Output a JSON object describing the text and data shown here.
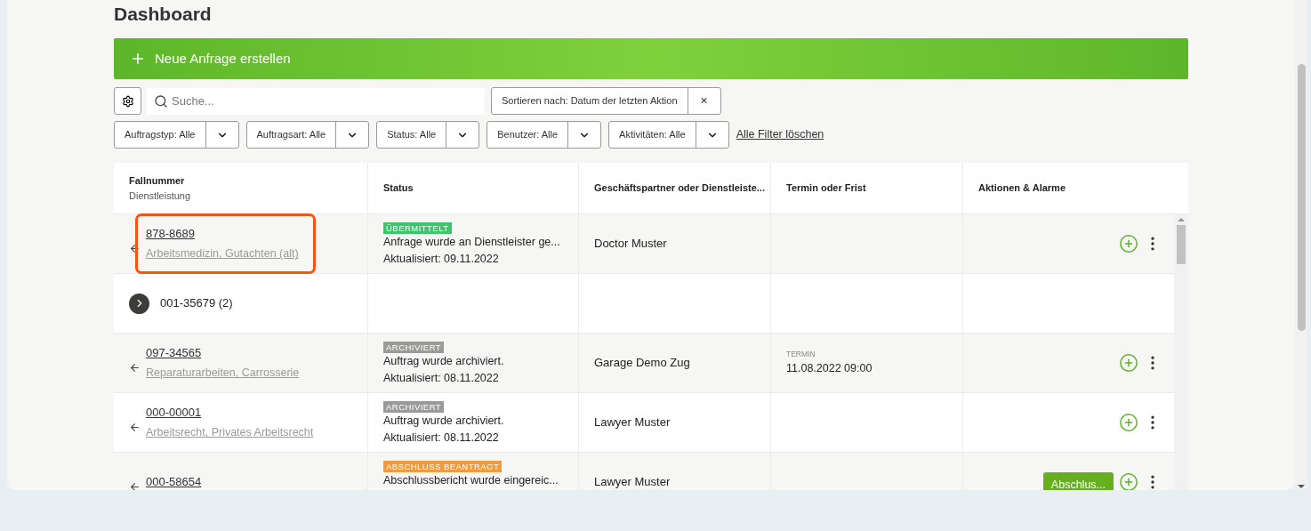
{
  "page_title": "Dashboard",
  "create_button": {
    "label": "Neue Anfrage erstellen"
  },
  "search": {
    "placeholder": "Suche..."
  },
  "sort": {
    "label": "Sortieren nach: Datum der letzten Aktion",
    "clear": "×"
  },
  "filters": [
    {
      "label": "Auftragstyp: Alle"
    },
    {
      "label": "Auftragsart: Alle"
    },
    {
      "label": "Status: Alle"
    },
    {
      "label": "Benutzer: Alle"
    },
    {
      "label": "Aktivitäten: Alle"
    }
  ],
  "clear_filters": "Alle Filter löschen",
  "table": {
    "columns": [
      {
        "title": "Fallnummer",
        "subtitle": "Dienstleistung"
      },
      {
        "title": "Status"
      },
      {
        "title": "Geschäftspartner oder Dienstleiste..."
      },
      {
        "title": "Termin oder Frist"
      },
      {
        "title": "Aktionen & Alarme"
      }
    ],
    "rows": [
      {
        "kind": "case",
        "highlighted": true,
        "number": "878-8689",
        "service": "Arbeitsmedizin, Gutachten (alt)",
        "badge": "ÜBERMITTELT",
        "color": "#3fc36b",
        "message": "Anfrage wurde an Dienstleister ge...",
        "updated": "Aktualisiert: 09.11.2022",
        "partner": "Doctor Muster"
      },
      {
        "kind": "group",
        "number": "001-35679 (2)"
      },
      {
        "kind": "case",
        "highlighted": false,
        "number": "097-34565",
        "service": "Reparaturarbeiten, Carrosserie",
        "badge": "ARCHIVIERT",
        "color": "#9a9a98",
        "message": "Auftrag wurde archiviert.",
        "updated": "Aktualisiert: 08.11.2022",
        "partner": "Garage Demo Zug",
        "deadline_label": "TERMIN",
        "deadline": "11.08.2022 09:00"
      },
      {
        "kind": "case",
        "highlighted": false,
        "number": "000-00001",
        "service": "Arbeitsrecht, Privates Arbeitsrecht",
        "badge": "ARCHIVIERT",
        "color": "#9a9a98",
        "message": "Auftrag wurde archiviert.",
        "updated": "Aktualisiert: 08.11.2022",
        "partner": "Lawyer Muster"
      },
      {
        "kind": "case",
        "highlighted": false,
        "number": "000-58654",
        "badge": "ABSCHLUSS BEANTRAGT",
        "color": "#f39a3c",
        "message": "Abschlussbericht wurde eingereic...",
        "partner": "Lawyer Muster",
        "action": "Abschlus..."
      }
    ]
  }
}
